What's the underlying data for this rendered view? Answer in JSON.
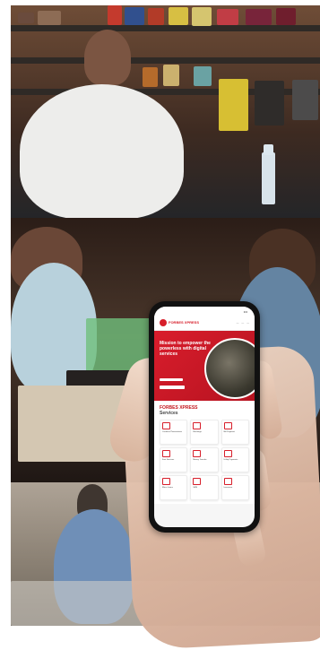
{
  "phone_screen": {
    "logo_text": "FORBES XPRESS",
    "hero_title": "Mission to empower the powerless with digital services",
    "hero_copy": "",
    "hero_cta": "",
    "services_title": "FORBES XPRESS",
    "services_subtitle": "Services",
    "service_cards": [
      {
        "label": "Cashless/Transactions",
        "icon": "card-icon"
      },
      {
        "label": "Recharge",
        "icon": "phone-icon"
      },
      {
        "label": "Bill Payment",
        "icon": "bill-icon"
      },
      {
        "label": "Fast Services",
        "icon": "keyboard-icon"
      },
      {
        "label": "Money Transfer",
        "icon": "transfer-icon"
      },
      {
        "label": "Utility Payments",
        "icon": "utility-icon"
      },
      {
        "label": "Micro Loans",
        "icon": "loan-icon"
      },
      {
        "label": "SMS",
        "icon": "sms-icon"
      },
      {
        "label": "Insurance",
        "icon": "insurance-icon"
      }
    ]
  }
}
